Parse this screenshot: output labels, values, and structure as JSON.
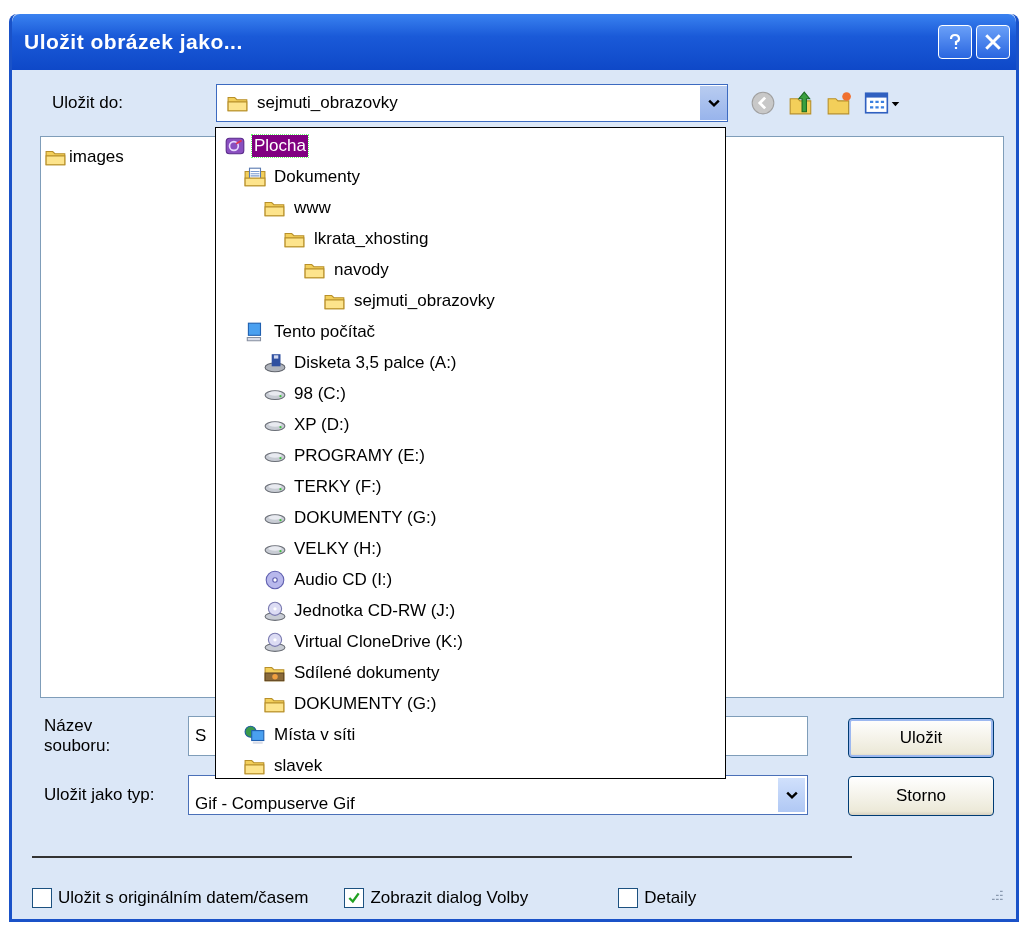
{
  "window": {
    "title": "Uložit obrázek jako..."
  },
  "save_in": {
    "label": "Uložit do:",
    "value": "sejmuti_obrazovky",
    "expanded": true
  },
  "file_list": [
    {
      "name": "images",
      "kind": "folder"
    }
  ],
  "location_list": [
    {
      "label": "Plocha",
      "kind": "desktop",
      "selected": true,
      "children": [
        {
          "label": "Dokumenty",
          "kind": "documents",
          "selected": false,
          "children": [
            {
              "label": "www",
              "kind": "folder",
              "selected": false,
              "children": [
                {
                  "label": "lkrata_xhosting",
                  "kind": "folder",
                  "selected": false,
                  "children": [
                    {
                      "label": "navody",
                      "kind": "folder",
                      "selected": false,
                      "children": [
                        {
                          "label": "sejmuti_obrazovky",
                          "kind": "folder",
                          "selected": false
                        }
                      ]
                    }
                  ]
                }
              ]
            }
          ]
        },
        {
          "label": "Tento počítač",
          "kind": "computer",
          "selected": false,
          "children": [
            {
              "label": "Disketa 3,5 palce (A:)",
              "kind": "floppy",
              "selected": false
            },
            {
              "label": "98 (C:)",
              "kind": "drive",
              "selected": false
            },
            {
              "label": "XP (D:)",
              "kind": "drive",
              "selected": false
            },
            {
              "label": "PROGRAMY (E:)",
              "kind": "drive",
              "selected": false
            },
            {
              "label": "TERKY (F:)",
              "kind": "drive",
              "selected": false
            },
            {
              "label": "DOKUMENTY (G:)",
              "kind": "drive",
              "selected": false
            },
            {
              "label": "VELKY (H:)",
              "kind": "drive",
              "selected": false
            },
            {
              "label": "Audio CD (I:)",
              "kind": "cd",
              "selected": false
            },
            {
              "label": "Jednotka CD-RW (J:)",
              "kind": "cdrw",
              "selected": false
            },
            {
              "label": "Virtual CloneDrive (K:)",
              "kind": "cdrw",
              "selected": false
            },
            {
              "label": "Sdílené dokumenty",
              "kind": "shared",
              "selected": false
            },
            {
              "label": "DOKUMENTY (G:)",
              "kind": "folder",
              "selected": false
            }
          ]
        },
        {
          "label": "Místa v síti",
          "kind": "network",
          "selected": false
        },
        {
          "label": "slavek",
          "kind": "folder",
          "selected": false
        }
      ]
    }
  ],
  "file_name": {
    "label": "Název souboru:",
    "value": "S"
  },
  "file_type": {
    "label": "Uložit jako typ:",
    "value": "Gif - Compuserve Gif"
  },
  "buttons": [
    {
      "label": "Uložit",
      "kind": "save"
    },
    {
      "label": "Storno",
      "kind": "cancel"
    }
  ],
  "options": [
    {
      "label": "Uložit s originálním datem/časem",
      "checked": false
    },
    {
      "label": "Zobrazit dialog Volby",
      "checked": true
    },
    {
      "label": "Detaily",
      "checked": false
    }
  ]
}
